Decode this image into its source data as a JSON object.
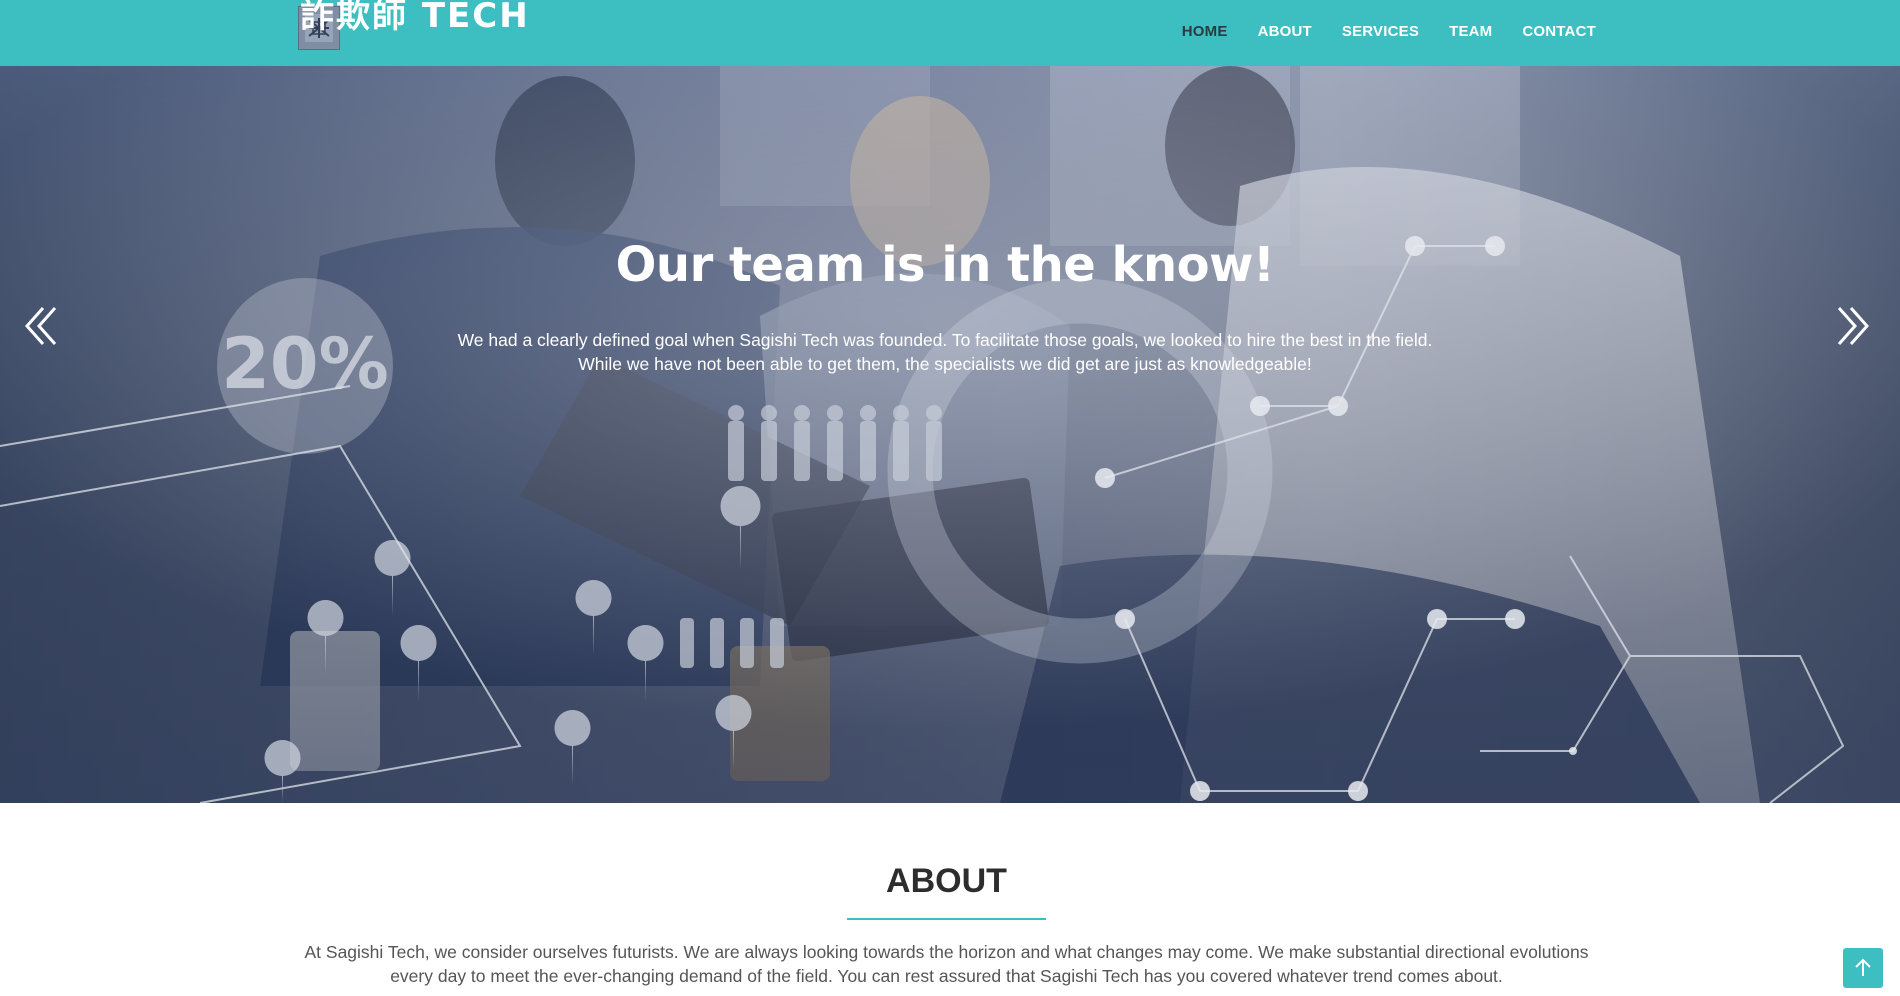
{
  "header": {
    "logo_text": "詐欺師 TECH",
    "nav": [
      {
        "label": "HOME"
      },
      {
        "label": "ABOUT"
      },
      {
        "label": "SERVICES"
      },
      {
        "label": "TEAM"
      },
      {
        "label": "CONTACT"
      }
    ]
  },
  "hero": {
    "title": "Our team is in the know!",
    "text": "We had a clearly defined goal when Sagishi Tech was founded. To facilitate those goals, we looked to hire the best in the field. While we have not been able to get them, the specialists we did get are just as knowledgeable!",
    "overlay_stat": "20%"
  },
  "about": {
    "title": "ABOUT",
    "text": "At Sagishi Tech, we consider ourselves futurists. We are always looking towards the horizon and what changes may come. We make substantial directional evolutions every day to meet the ever-changing demand of the field. You can rest assured that Sagishi Tech has you covered whatever trend comes about."
  },
  "colors": {
    "accent": "#3dbec1",
    "nav_active": "#2c3b3e",
    "hero_overlay": "#5f7090"
  },
  "icons": {
    "prev": "double-chevron-left-icon",
    "next": "double-chevron-right-icon",
    "back_to_top": "arrow-up-icon"
  }
}
